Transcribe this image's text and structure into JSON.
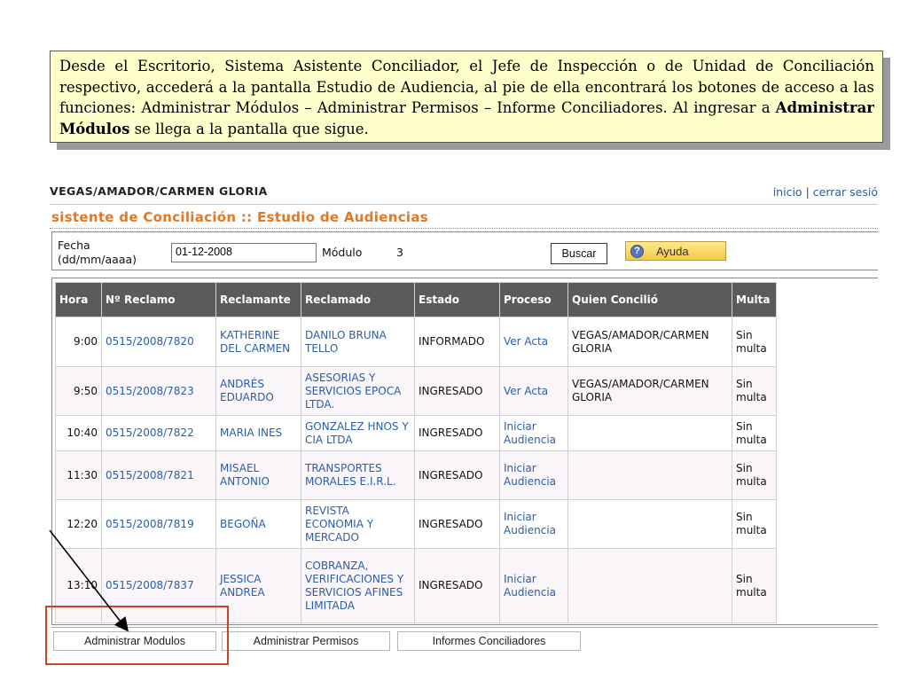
{
  "callout": {
    "text1": "Desde el Escritorio, Sistema Asistente Conciliador, el Jefe de Inspección o de  Unidad de Conciliación respectivo, accederá a la pantalla Estudio de Audiencia, al pie de ella encontrará los botones de acceso a las funciones: Administrar Módulos – Administrar Permisos – Informe Conciliadores. Al ingresar a ",
    "bold": "Administrar Módulos",
    "text2": " se llega a la pantalla que sigue."
  },
  "header": {
    "user": "VEGAS/AMADOR/CARMEN GLORIA",
    "link_inicio": "inicio",
    "separator": "|",
    "link_cerrar": "cerrar sesió",
    "title": "sistente de Conciliación :: Estudio de Audiencias"
  },
  "filter": {
    "fecha_label_1": "Fecha",
    "fecha_label_2": "(dd/mm/aaaa)",
    "fecha_value": "01-12-2008",
    "modulo_label": "Módulo",
    "modulo_value": "3",
    "buscar_label": "Buscar",
    "ayuda_label": "Ayuda"
  },
  "table": {
    "headers": [
      "Hora",
      "Nº Reclamo",
      "Reclamante",
      "Reclamado",
      "Estado",
      "Proceso",
      "Quien Concilió",
      "Multa"
    ],
    "rows": [
      {
        "hora": "9:00",
        "reclamo": "0515/2008/7820",
        "reclamante": "KATHERINE DEL CARMEN",
        "reclamado": "DANILO BRUNA TELLO",
        "estado": "INFORMADO",
        "proceso": "Ver Acta",
        "quien": "VEGAS/AMADOR/CARMEN GLORIA",
        "multa": "Sin multa"
      },
      {
        "hora": "9:50",
        "reclamo": "0515/2008/7823",
        "reclamante": "ANDRÉS EDUARDO",
        "reclamado": "ASESORIAS Y SERVICIOS EPOCA LTDA.",
        "estado": "INGRESADO",
        "proceso": "Ver Acta",
        "quien": "VEGAS/AMADOR/CARMEN GLORIA",
        "multa": "Sin multa"
      },
      {
        "hora": "10:40",
        "reclamo": "0515/2008/7822",
        "reclamante": "MARIA INES",
        "reclamado": "GONZALEZ HNOS Y CIA LTDA",
        "estado": "INGRESADO",
        "proceso": "Iniciar Audiencia",
        "quien": "",
        "multa": "Sin multa"
      },
      {
        "hora": "11:30",
        "reclamo": "0515/2008/7821",
        "reclamante": "MISAEL ANTONIO",
        "reclamado": "TRANSPORTES MORALES E.I.R.L.",
        "estado": "INGRESADO",
        "proceso": "Iniciar Audiencia",
        "quien": "",
        "multa": "Sin multa"
      },
      {
        "hora": "12:20",
        "reclamo": "0515/2008/7819",
        "reclamante": "BEGOÑA",
        "reclamado": "REVISTA ECONOMIA Y MERCADO",
        "estado": "INGRESADO",
        "proceso": "Iniciar Audiencia",
        "quien": "",
        "multa": "Sin multa"
      },
      {
        "hora": "13:10",
        "reclamo": "0515/2008/7837",
        "reclamante": "JESSICA ANDREA",
        "reclamado": "COBRANZA, VERIFICACIONES Y SERVICIOS AFINES LIMITADA",
        "estado": "INGRESADO",
        "proceso": "Iniciar Audiencia",
        "quien": "",
        "multa": "Sin multa"
      }
    ]
  },
  "buttons": {
    "administrar_modulos": "Administrar Modulos",
    "administrar_permisos": "Administrar Permisos",
    "informes_conciliadores": "Informes Conciliadores"
  },
  "annotation": {
    "highlight_color": "#c8452a"
  }
}
